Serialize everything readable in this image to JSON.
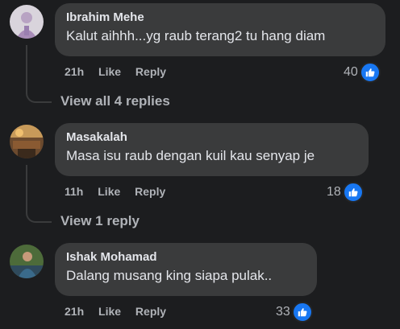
{
  "comments": [
    {
      "author": "Ibrahim Mehe",
      "text": "Kalut aihhh...yg raub terang2 tu hang diam",
      "time": "21h",
      "like_label": "Like",
      "reply_label": "Reply",
      "reaction_count": "40"
    },
    {
      "author": "Masakalah",
      "text": "Masa isu raub dengan kuil kau senyap je",
      "time": "11h",
      "like_label": "Like",
      "reply_label": "Reply",
      "reaction_count": "18"
    },
    {
      "author": "Ishak Mohamad",
      "text": "Dalang musang king siapa pulak..",
      "time": "21h",
      "like_label": "Like",
      "reply_label": "Reply",
      "reaction_count": "33"
    }
  ],
  "view_replies": [
    {
      "label": "View all 4 replies"
    },
    {
      "label": "View 1 reply"
    }
  ],
  "icons": {
    "reaction": "like-thumb-icon"
  },
  "colors": {
    "background": "#1c1d1f",
    "bubble": "#3a3b3c",
    "primary_text": "#e4e6eb",
    "secondary_text": "#b0b3b8",
    "like_blue": "#1877f2"
  }
}
